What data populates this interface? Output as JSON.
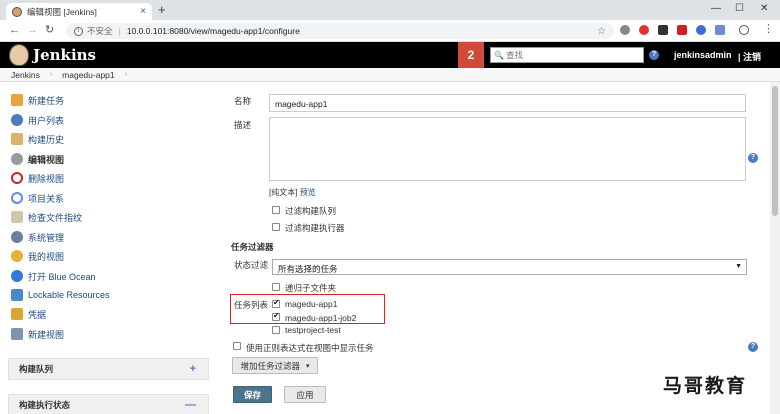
{
  "browser": {
    "tab_title": "编辑视图 [Jenkins]",
    "tab_close": "×",
    "new_tab": "+",
    "security_label": "不安全",
    "url": "10.0.0.101:8080/view/magedu-app1/configure",
    "controls": {
      "minimize": "—",
      "maximize": "☐",
      "close": "✕"
    }
  },
  "header": {
    "logo_text": "Jenkins",
    "notification_count": "2",
    "search_placeholder": "查找",
    "help": "?",
    "username": "jenkinsadmin",
    "logout": "| 注销"
  },
  "breadcrumb": [
    "Jenkins",
    "magedu-app1"
  ],
  "sidebar": {
    "items": [
      {
        "label": "新建任务",
        "icon": "new-item-icon",
        "color": "#e8a33b"
      },
      {
        "label": "用户列表",
        "icon": "people-icon",
        "color": "#4a7ac4"
      },
      {
        "label": "构建历史",
        "icon": "notepad-icon",
        "color": "#d9b36c"
      },
      {
        "label": "编辑视图",
        "icon": "gear-icon",
        "color": "#9a9a9a"
      },
      {
        "label": "删除视图",
        "icon": "no-entry-icon",
        "color": "#cc2222"
      },
      {
        "label": "项目关系",
        "icon": "search-icon",
        "color": "#5b8fd6"
      },
      {
        "label": "检查文件指纹",
        "icon": "fingerprint-icon",
        "color": "#cfc7a8"
      },
      {
        "label": "系统管理",
        "icon": "gear-icon",
        "color": "#6b7f9a"
      },
      {
        "label": "我的视图",
        "icon": "user-icon",
        "color": "#e5b03b"
      },
      {
        "label": "打开 Blue Ocean",
        "icon": "blue-ocean-icon",
        "color": "#2f7bd6"
      },
      {
        "label": "Lockable Resources",
        "icon": "lock-icon",
        "color": "#4a89c9"
      },
      {
        "label": "凭据",
        "icon": "key-icon",
        "color": "#d7a72f"
      },
      {
        "label": "新建视图",
        "icon": "folder-icon",
        "color": "#7e93ad"
      }
    ],
    "build_queue": "构建队列",
    "build_queue_toggle": "+",
    "executor_status": "构建执行状态",
    "executor_toggle": "—"
  },
  "form": {
    "name_label": "名称",
    "name_value": "magedu-app1",
    "desc_label": "描述",
    "desc_value": "",
    "plain_text": "[纯文本]",
    "preview": "预览",
    "filter_queue": "过滤构建队列",
    "filter_executors": "过滤构建执行器",
    "job_filter_title": "任务过滤器",
    "status_filter_label": "状态过滤",
    "status_filter_value": "所有选择的任务",
    "recurse_label": "递归子文件夹",
    "job_list_label": "任务列表",
    "jobs": [
      {
        "name": "magedu-app1",
        "checked": true
      },
      {
        "name": "magedu-app1-job2",
        "checked": true
      },
      {
        "name": "testproject-test",
        "checked": false
      }
    ],
    "regex_label": "使用正则表达式在视图中显示任务",
    "add_filter_button": "增加任务过滤器",
    "add_filter_caret": "▾",
    "save_button": "保存",
    "apply_button": "应用",
    "help": "?"
  },
  "watermark": {
    "text": "马哥教育",
    "icon": "M"
  }
}
